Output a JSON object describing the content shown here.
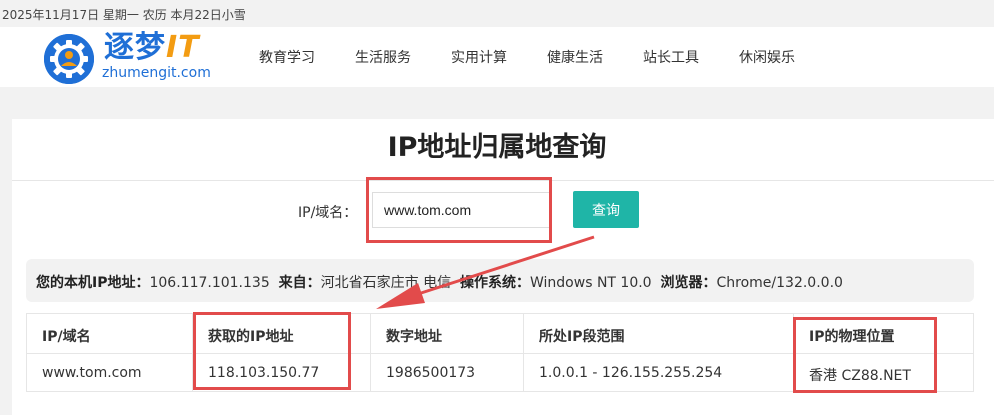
{
  "topbar": {
    "date_text": "2025年11月17日 星期一 农历 本月22日小雪"
  },
  "brand": {
    "name_cn": "逐梦",
    "name_it": "IT",
    "domain": "zhumengit.com"
  },
  "nav": [
    "教育学习",
    "生活服务",
    "实用计算",
    "健康生活",
    "站长工具",
    "休闲娱乐"
  ],
  "page": {
    "title": "IP地址归属地查询"
  },
  "search": {
    "label": "IP/域名：",
    "value": "www.tom.com",
    "button_label": "查询"
  },
  "local_info": {
    "ip_label": "您的本机IP地址：",
    "ip_value": "106.117.101.135",
    "from_label": "来自：",
    "from_value": "河北省石家庄市 电信",
    "os_label": "操作系统：",
    "os_value": "Windows NT 10.0",
    "browser_label": "浏览器：",
    "browser_value": "Chrome/132.0.0.0"
  },
  "results": {
    "headers": [
      "IP/域名",
      "获取的IP地址",
      "数字地址",
      "所处IP段范围",
      "IP的物理位置"
    ],
    "row": [
      "www.tom.com",
      "118.103.150.77",
      "1986500173",
      "1.0.0.1 - 126.155.255.254",
      "香港 CZ88.NET"
    ]
  },
  "colors": {
    "brand_blue": "#1f6fd6",
    "accent_orange": "#f39c12",
    "button_teal": "#1fb5a7",
    "annotation_red": "#e24b4b"
  },
  "icons": {
    "logo": "gear-person-icon"
  }
}
